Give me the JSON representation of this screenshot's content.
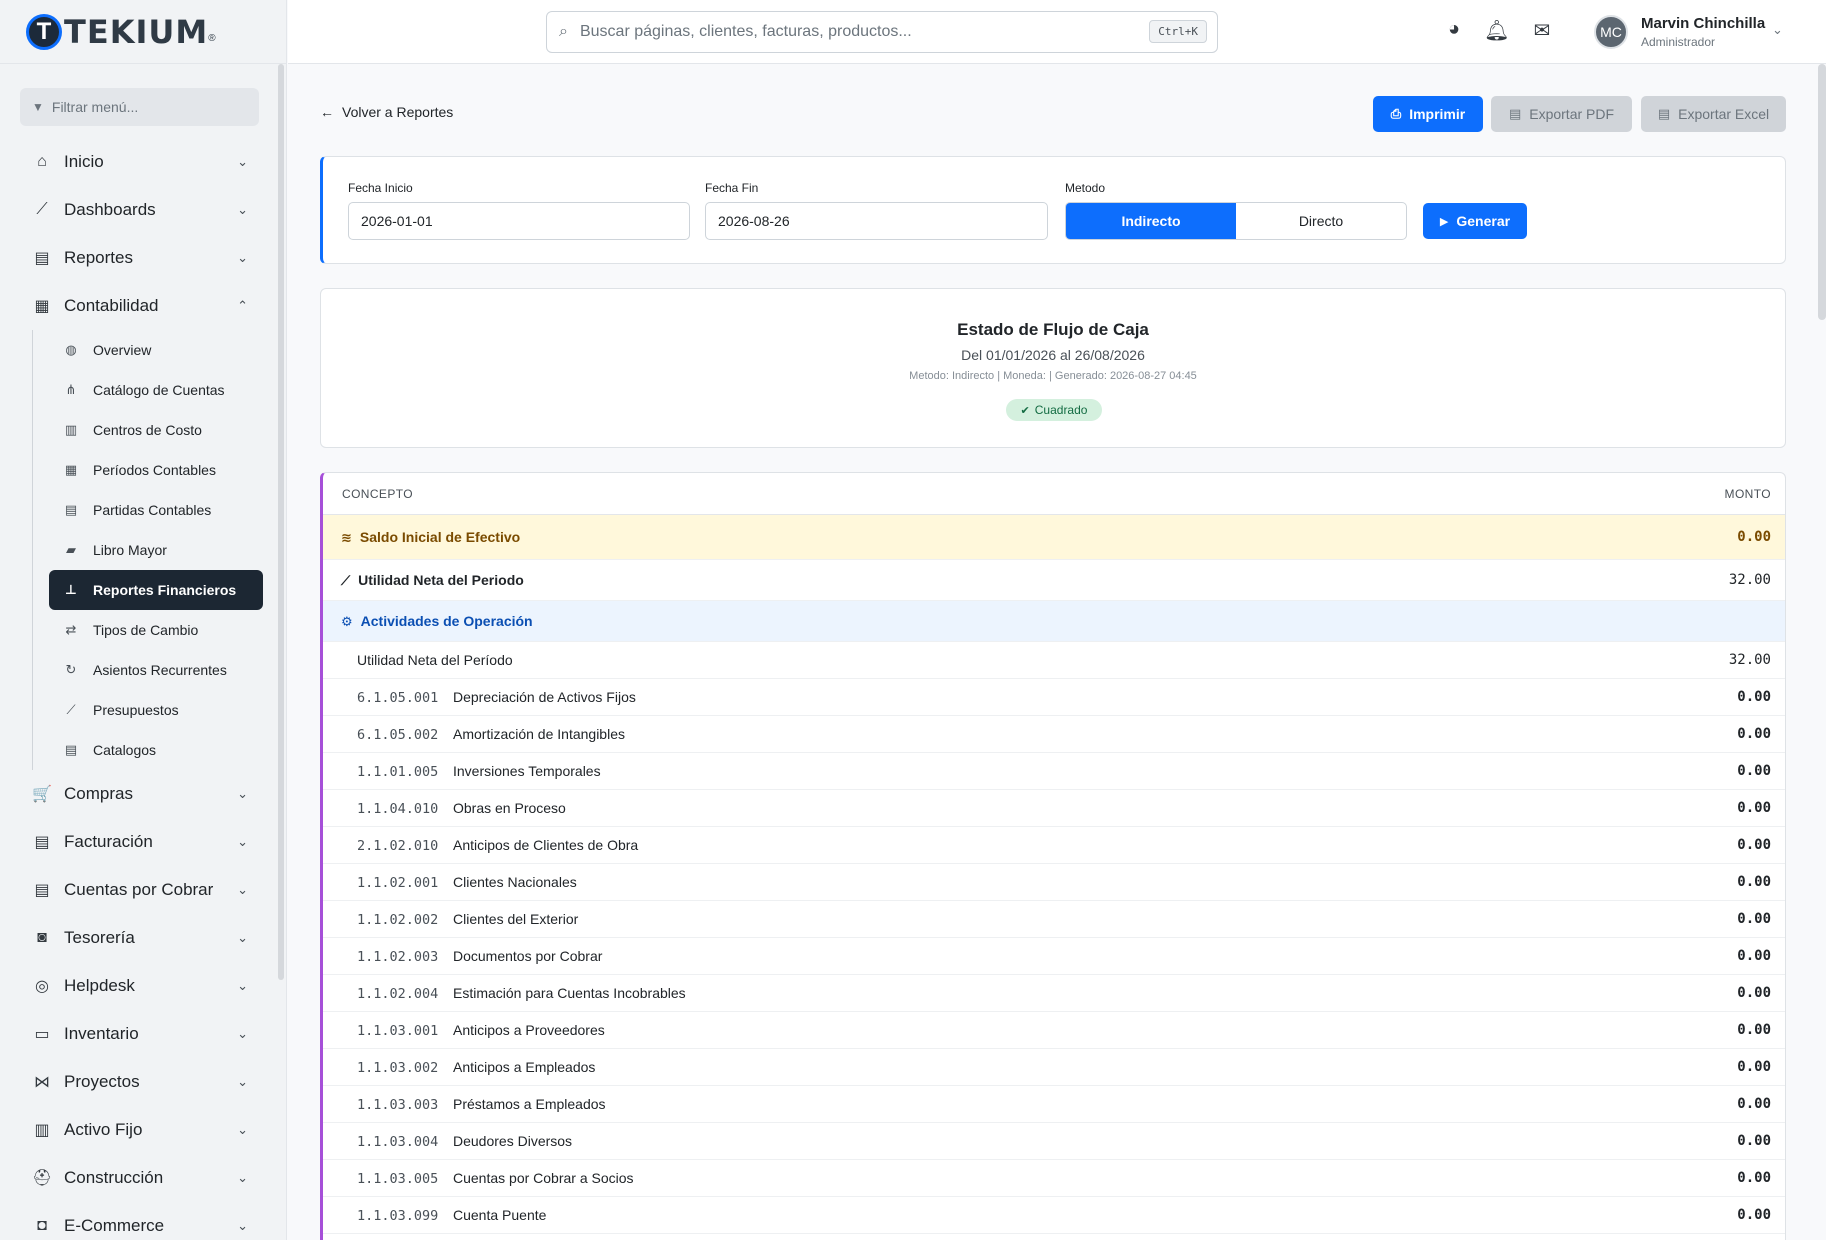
{
  "brand": {
    "name": "TEKIUM",
    "mark": "T",
    "reg": "®"
  },
  "sidebar": {
    "filter_placeholder": "Filtrar menú...",
    "items_top": [
      {
        "label": "Inicio",
        "icon": "⌂"
      },
      {
        "label": "Dashboards",
        "icon": "⟋"
      },
      {
        "label": "Reportes",
        "icon": "▤"
      },
      {
        "label": "Contabilidad",
        "icon": "▦"
      }
    ],
    "sub_items": [
      {
        "label": "Overview",
        "icon": "◍"
      },
      {
        "label": "Catálogo de Cuentas",
        "icon": "⋔"
      },
      {
        "label": "Centros de Costo",
        "icon": "▥"
      },
      {
        "label": "Períodos Contables",
        "icon": "▦"
      },
      {
        "label": "Partidas Contables",
        "icon": "▤"
      },
      {
        "label": "Libro Mayor",
        "icon": "▰"
      },
      {
        "label": "Reportes Financieros",
        "icon": "⊥"
      },
      {
        "label": "Tipos de Cambio",
        "icon": "⇄"
      },
      {
        "label": "Asientos Recurrentes",
        "icon": "↻"
      },
      {
        "label": "Presupuestos",
        "icon": "⟋"
      },
      {
        "label": "Catalogos",
        "icon": "▤"
      }
    ],
    "items_bottom": [
      {
        "label": "Compras",
        "icon": "🛒"
      },
      {
        "label": "Facturación",
        "icon": "▤"
      },
      {
        "label": "Cuentas por Cobrar",
        "icon": "▤"
      },
      {
        "label": "Tesorería",
        "icon": "◙"
      },
      {
        "label": "Helpdesk",
        "icon": "◎"
      },
      {
        "label": "Inventario",
        "icon": "▭"
      },
      {
        "label": "Proyectos",
        "icon": "⋈"
      },
      {
        "label": "Activo Fijo",
        "icon": "▥"
      },
      {
        "label": "Construcción",
        "icon": "⛑"
      },
      {
        "label": "E-Commerce",
        "icon": "◘"
      }
    ]
  },
  "topbar": {
    "search_placeholder": "Buscar páginas, clientes, facturas, productos...",
    "shortcut": "Ctrl+K",
    "user": {
      "initials": "MC",
      "name": "Marvin Chinchilla",
      "role": "Administrador"
    }
  },
  "toolbar": {
    "back": "Volver a Reportes",
    "print": "Imprimir",
    "pdf": "Exportar PDF",
    "excel": "Exportar Excel"
  },
  "filters": {
    "start_label": "Fecha Inicio",
    "start_value": "2026-01-01",
    "end_label": "Fecha Fin",
    "end_value": "2026-08-26",
    "method_label": "Metodo",
    "method_indirect": "Indirecto",
    "method_direct": "Directo",
    "generate": "Generar"
  },
  "report": {
    "title": "Estado de Flujo de Caja",
    "period": "Del 01/01/2026 al 26/08/2026",
    "meta": "Metodo: Indirecto | Moneda: | Generado: 2026-08-27 04:45",
    "badge": "Cuadrado"
  },
  "table": {
    "col_concept": "CONCEPTO",
    "col_amount": "MONTO",
    "initial": {
      "label": "Saldo Inicial de Efectivo",
      "amount": "0.00"
    },
    "net": {
      "label": "Utilidad Neta del Periodo",
      "amount": "32.00"
    },
    "section": {
      "label": "Actividades de Operación"
    },
    "lines": [
      {
        "code": "",
        "label": "Utilidad Neta del Período",
        "amount": "32.00"
      },
      {
        "code": "6.1.05.001",
        "label": "Depreciación de Activos Fijos",
        "amount": "0.00"
      },
      {
        "code": "6.1.05.002",
        "label": "Amortización de Intangibles",
        "amount": "0.00"
      },
      {
        "code": "1.1.01.005",
        "label": "Inversiones Temporales",
        "amount": "0.00"
      },
      {
        "code": "1.1.04.010",
        "label": "Obras en Proceso",
        "amount": "0.00"
      },
      {
        "code": "2.1.02.010",
        "label": "Anticipos de Clientes de Obra",
        "amount": "0.00"
      },
      {
        "code": "1.1.02.001",
        "label": "Clientes Nacionales",
        "amount": "0.00"
      },
      {
        "code": "1.1.02.002",
        "label": "Clientes del Exterior",
        "amount": "0.00"
      },
      {
        "code": "1.1.02.003",
        "label": "Documentos por Cobrar",
        "amount": "0.00"
      },
      {
        "code": "1.1.02.004",
        "label": "Estimación para Cuentas Incobrables",
        "amount": "0.00"
      },
      {
        "code": "1.1.03.001",
        "label": "Anticipos a Proveedores",
        "amount": "0.00"
      },
      {
        "code": "1.1.03.002",
        "label": "Anticipos a Empleados",
        "amount": "0.00"
      },
      {
        "code": "1.1.03.003",
        "label": "Préstamos a Empleados",
        "amount": "0.00"
      },
      {
        "code": "1.1.03.004",
        "label": "Deudores Diversos",
        "amount": "0.00"
      },
      {
        "code": "1.1.03.005",
        "label": "Cuentas por Cobrar a Socios",
        "amount": "0.00"
      },
      {
        "code": "1.1.03.099",
        "label": "Cuenta Puente",
        "amount": "0.00"
      }
    ]
  },
  "colors": {
    "primary": "#0d6efd",
    "sidebar_active": "#1c2733",
    "table_accent": "#a64fd8",
    "success": "#146c43"
  }
}
